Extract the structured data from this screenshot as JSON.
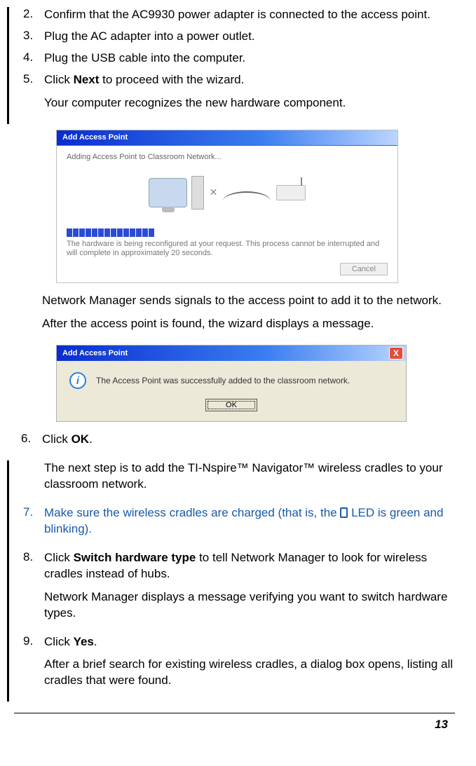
{
  "steps": {
    "s2": {
      "num": "2.",
      "text": "Confirm that the AC9930 power adapter is connected to the access point."
    },
    "s3": {
      "num": "3.",
      "text": "Plug the AC adapter into a power outlet."
    },
    "s4": {
      "num": "4.",
      "text": "Plug the USB cable into the computer."
    },
    "s5": {
      "num": "5.",
      "pre": "Click ",
      "bold": "Next",
      "post": " to proceed with the wizard.",
      "result": "Your computer recognizes the new hardware component."
    },
    "s5b": {
      "line1": "Network Manager sends signals to the access point to add it to the network.",
      "line2": "After the access point is found, the wizard displays a message."
    },
    "s6": {
      "num": "6.",
      "pre": "Click ",
      "bold": "OK",
      "post": ".",
      "result": "The next step is to add the TI-Nspire™ Navigator™ wireless cradles to your classroom network."
    },
    "s7": {
      "num": "7.",
      "pre": "Make sure the wireless cradles are charged (that is, the ",
      "post": " LED is green and blinking)."
    },
    "s8": {
      "num": "8.",
      "pre": "Click ",
      "bold": "Switch hardware type",
      "post": " to tell Network Manager to look for wireless cradles instead of hubs.",
      "result": "Network Manager displays a message verifying you want to switch hardware types."
    },
    "s9": {
      "num": "9.",
      "pre": "Click ",
      "bold": "Yes",
      "post": ".",
      "result": "After a brief search for existing wireless cradles, a dialog box opens, listing all cradles that were found."
    }
  },
  "dialog1": {
    "title": "Add Access Point",
    "status": "Adding Access Point to Classroom Network...",
    "message": "The hardware is being reconfigured at your request. This process cannot be interrupted and will complete in approximately 20 seconds.",
    "cancel": "Cancel"
  },
  "dialog2": {
    "title": "Add Access Point",
    "message": "The Access Point was successfully added to the classroom network.",
    "ok": "OK",
    "close": "X"
  },
  "page_number": "13"
}
